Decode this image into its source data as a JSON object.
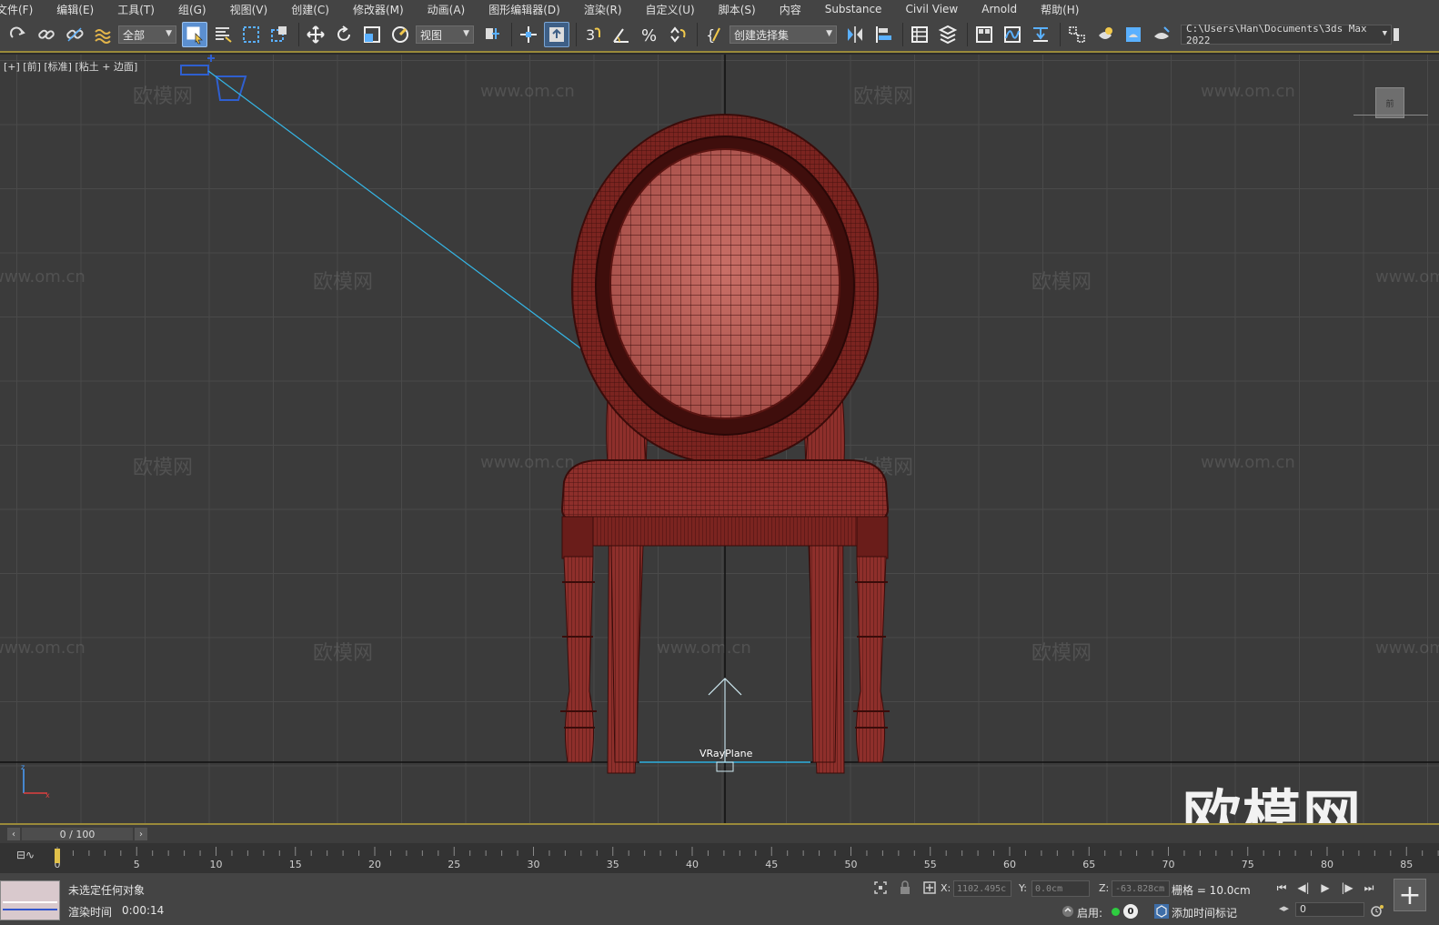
{
  "menu": [
    "文件(F)",
    "编辑(E)",
    "工具(T)",
    "组(G)",
    "视图(V)",
    "创建(C)",
    "修改器(M)",
    "动画(A)",
    "图形编辑器(D)",
    "渲染(R)",
    "自定义(U)",
    "脚本(S)",
    "内容",
    "Substance",
    "Civil View",
    "Arnold",
    "帮助(H)"
  ],
  "toolbar": {
    "selection_filter": "全部",
    "reference_coord": "视图",
    "named_selection": "创建选择集",
    "project_path": "C:\\Users\\Han\\Documents\\3ds Max 2022",
    "snap_label": "3"
  },
  "viewport": {
    "label": "[+] [前] [标准] [粘土 + 边面]",
    "object_label": "VRayPlane",
    "viewcube_label": "前",
    "watermarks_cn": "欧模网",
    "watermarks_url": "www.om.cn",
    "big_logo": "欧模网",
    "colors": {
      "background": "#3b3b3b",
      "grid": "#4a4a4a",
      "model": "#8e2f2b",
      "light_line": "#35b6e6"
    }
  },
  "timeline": {
    "frame_display": "0 / 100",
    "current_frame": 0,
    "total_frames": 100,
    "ruler_ticks": [
      "0",
      "5",
      "10",
      "15",
      "20",
      "25",
      "30",
      "35",
      "40",
      "45",
      "50",
      "55",
      "60",
      "65",
      "70",
      "75",
      "80",
      "85"
    ]
  },
  "status": {
    "message": "未选定任何对象",
    "render_time_label": "渲染时间",
    "render_time": "0:00:14",
    "x_label": "X:",
    "x_value": "1102.495c",
    "y_label": "Y:",
    "y_value": "0.0cm",
    "z_label": "Z:",
    "z_value": "-63.828cm",
    "grid": "栅格 = 10.0cm",
    "enable_label": "启用:",
    "badge": "0",
    "add_time_tag": "添加时间标记",
    "frame_field": "0"
  }
}
